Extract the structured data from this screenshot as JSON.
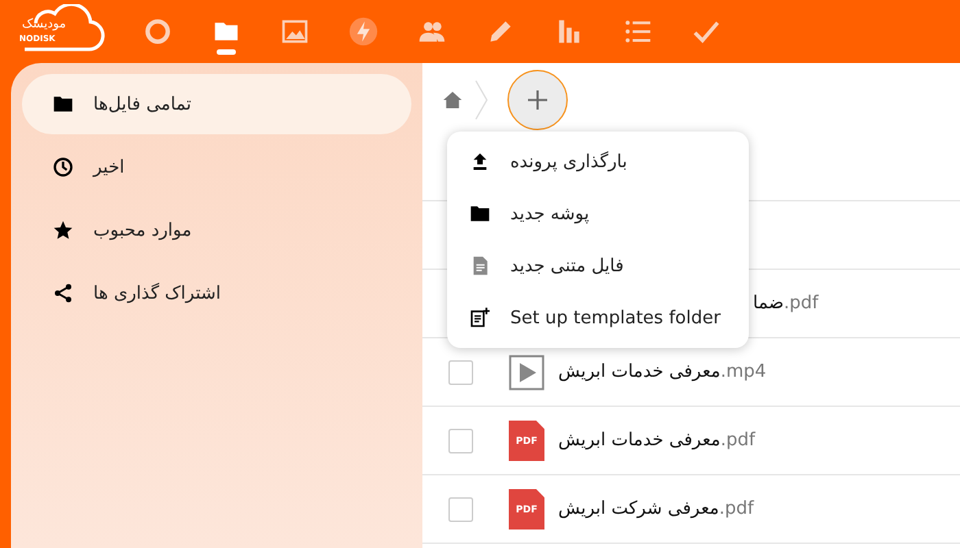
{
  "logo": {
    "text": "مودیسک",
    "subtext": "NODISK"
  },
  "nav": [
    {
      "kind": "circle",
      "selected": false
    },
    {
      "kind": "folder",
      "selected": true
    },
    {
      "kind": "image",
      "selected": false
    },
    {
      "kind": "bolt",
      "selected": false
    },
    {
      "kind": "people",
      "selected": false
    },
    {
      "kind": "pencil",
      "selected": false
    },
    {
      "kind": "bars",
      "selected": false
    },
    {
      "kind": "list",
      "selected": false
    },
    {
      "kind": "check",
      "selected": false
    }
  ],
  "sidebar": {
    "items": [
      {
        "kind": "folder",
        "label": "تمامی فایل‌ها",
        "selected": true
      },
      {
        "kind": "clock",
        "label": "اخیر",
        "selected": false
      },
      {
        "kind": "star",
        "label": "موارد محبوب",
        "selected": false
      },
      {
        "kind": "share",
        "label": "اشتراک گذاری ها",
        "selected": false
      }
    ]
  },
  "new_menu": {
    "items": [
      {
        "kind": "upload",
        "label": "بارگذاری پرونده"
      },
      {
        "kind": "folder",
        "label": "پوشه جدید"
      },
      {
        "kind": "text",
        "label": "فایل متنی جدید"
      },
      {
        "kind": "template",
        "label": "Set up templates folder"
      }
    ]
  },
  "files": [
    {
      "kind": "partial",
      "name": "ضما",
      "ext": ".pdf"
    },
    {
      "kind": "video",
      "name": "معرفی خدمات ابریش",
      "ext": ".mp4",
      "checked": false
    },
    {
      "kind": "pdf",
      "name": "معرفی خدمات ابریش",
      "ext": ".pdf",
      "icon_label": "PDF",
      "checked": false
    },
    {
      "kind": "pdf",
      "name": "معرفی شرکت ابریش",
      "ext": ".pdf",
      "icon_label": "PDF",
      "checked": false
    }
  ]
}
